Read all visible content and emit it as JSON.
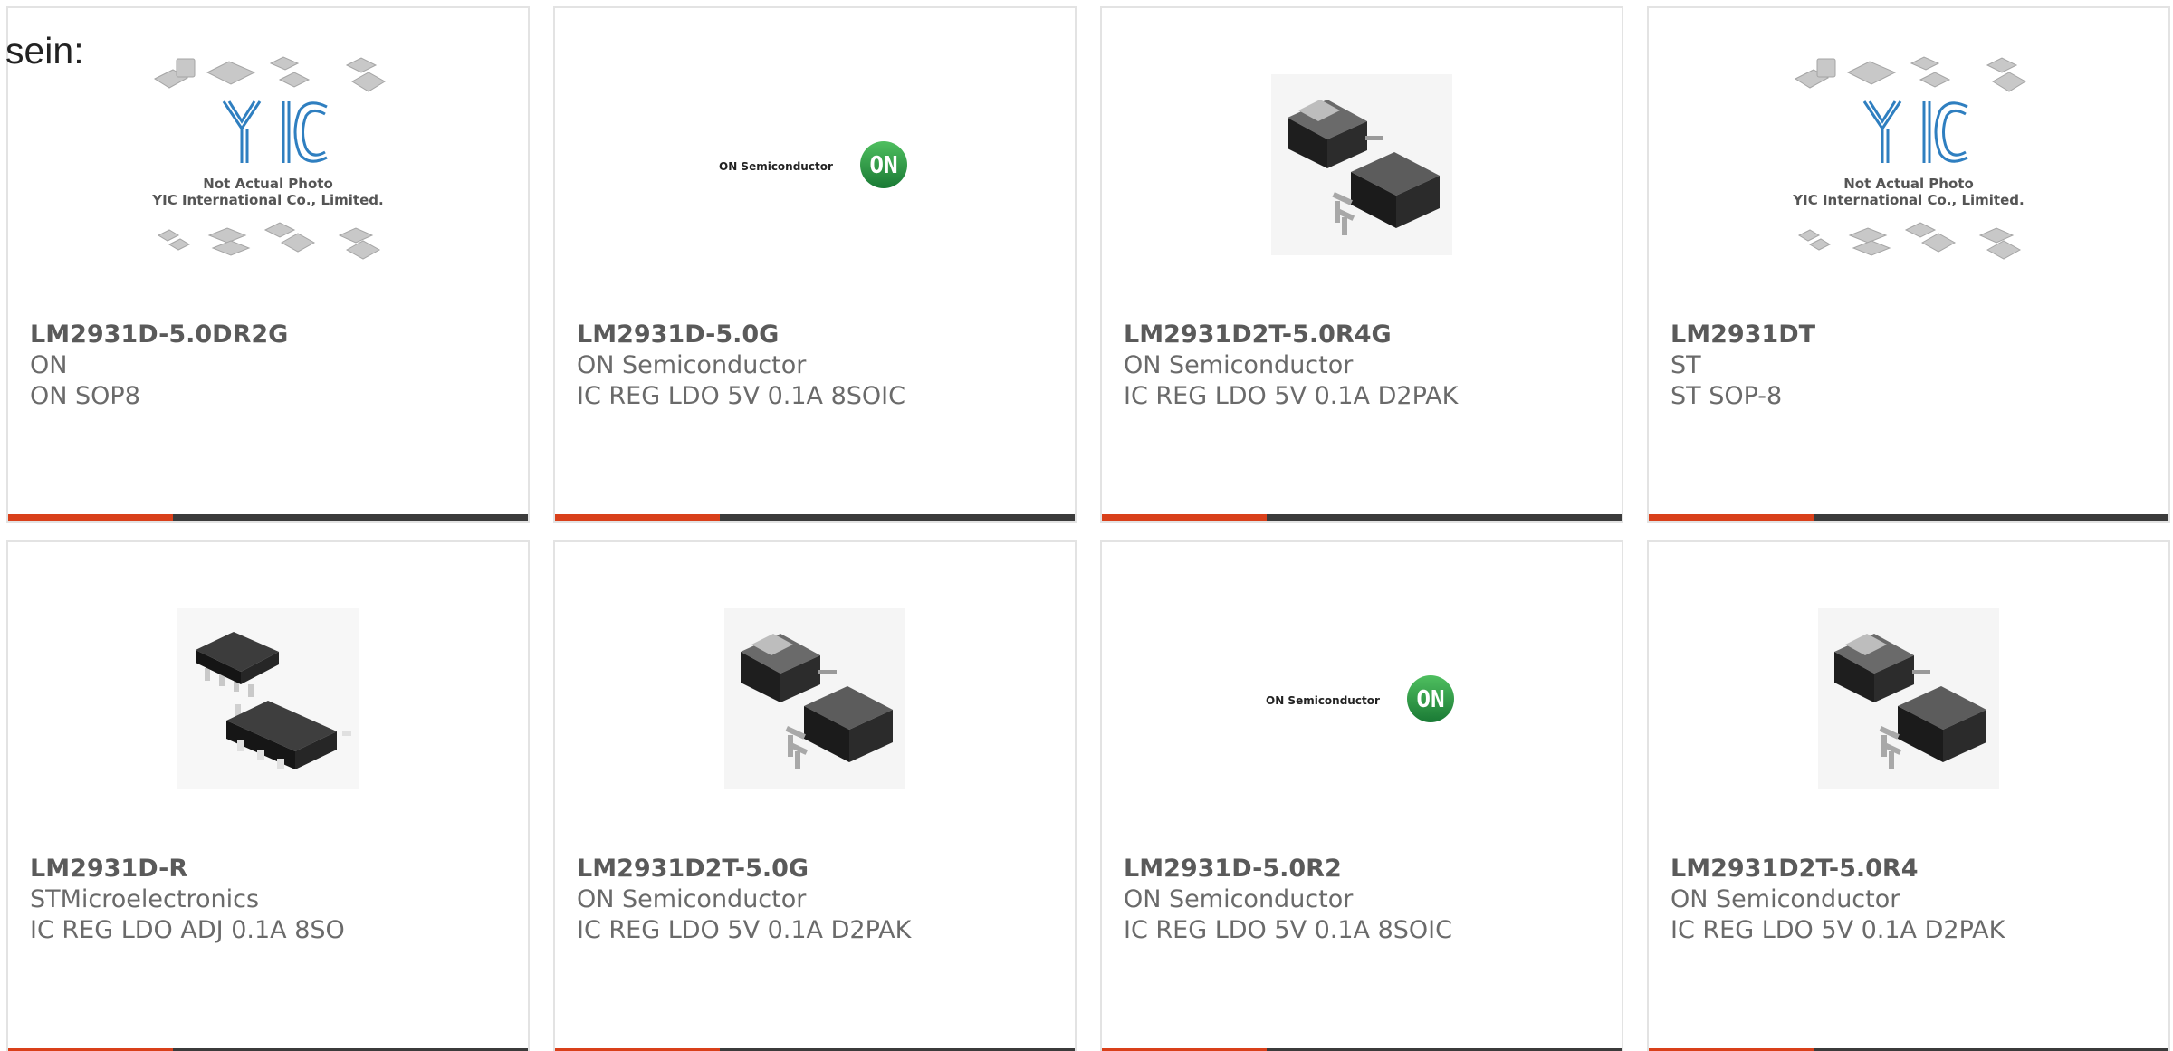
{
  "heading": "sein:",
  "placeholder_text": {
    "line1": "Not Actual Photo",
    "line2": "YIC International Co., Limited."
  },
  "on_logo": {
    "wordmark": "ON Semiconductor",
    "badge": "ON"
  },
  "colors": {
    "accent": "#d9401a",
    "bar": "#3b3b3b",
    "border": "#e3e3e3",
    "on_green": "#1f8a3c",
    "yic_blue": "#2f7fc0"
  },
  "products": [
    {
      "part": "LM2931D-5.0DR2G",
      "maker": "ON",
      "desc": "ON SOP8",
      "image": "yic-placeholder-icon"
    },
    {
      "part": "LM2931D-5.0G",
      "maker": "ON Semiconductor",
      "desc": "IC REG LDO 5V 0.1A 8SOIC",
      "image": "on-semiconductor-logo"
    },
    {
      "part": "LM2931D2T-5.0R4G",
      "maker": "ON Semiconductor",
      "desc": "IC REG LDO 5V 0.1A D2PAK",
      "image": "d2pak-chip-icon"
    },
    {
      "part": "LM2931DT",
      "maker": "ST",
      "desc": "ST SOP-8",
      "image": "yic-placeholder-icon"
    },
    {
      "part": "LM2931D-R",
      "maker": "STMicroelectronics",
      "desc": "IC REG LDO ADJ 0.1A 8SO",
      "image": "soic8-chip-icon"
    },
    {
      "part": "LM2931D2T-5.0G",
      "maker": "ON Semiconductor",
      "desc": "IC REG LDO 5V 0.1A D2PAK",
      "image": "d2pak-chip-icon"
    },
    {
      "part": "LM2931D-5.0R2",
      "maker": "ON Semiconductor",
      "desc": "IC REG LDO 5V 0.1A 8SOIC",
      "image": "on-semiconductor-logo"
    },
    {
      "part": "LM2931D2T-5.0R4",
      "maker": "ON Semiconductor",
      "desc": "IC REG LDO 5V 0.1A D2PAK",
      "image": "d2pak-chip-icon"
    }
  ]
}
